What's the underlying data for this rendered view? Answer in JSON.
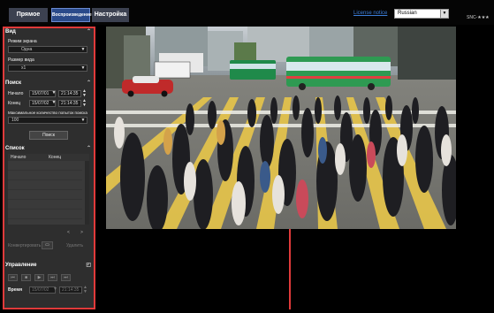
{
  "tabs": {
    "live": "Прямое",
    "playback": "Воспроизведение",
    "setup": "Настройка"
  },
  "license_link": "License notice",
  "language": {
    "selected": "Russian"
  },
  "model": "SNC-★★★",
  "view": {
    "title": "Вид",
    "mode_label": "Режим экрана",
    "mode_value": "Одна",
    "size_label": "Размер вида",
    "size_value": "x1"
  },
  "search": {
    "title": "Поиск",
    "start_label": "Начало",
    "start_date": "15/07/01",
    "start_time": "21:14:35",
    "end_label": "Конец",
    "end_date": "15/07/02",
    "end_time": "21:14:35",
    "max_label": "Максимальное количество попыток поиска",
    "max_value": "100",
    "button": "Поиск"
  },
  "list": {
    "title": "Список",
    "col_start": "Начало",
    "col_end": "Конец",
    "prev": "<",
    "next": ">",
    "convert": "Конвертировать",
    "delete": "Удалить"
  },
  "control": {
    "title": "Управление",
    "time_label": "Время",
    "date": "15/07/02",
    "time": "21:14:35"
  }
}
